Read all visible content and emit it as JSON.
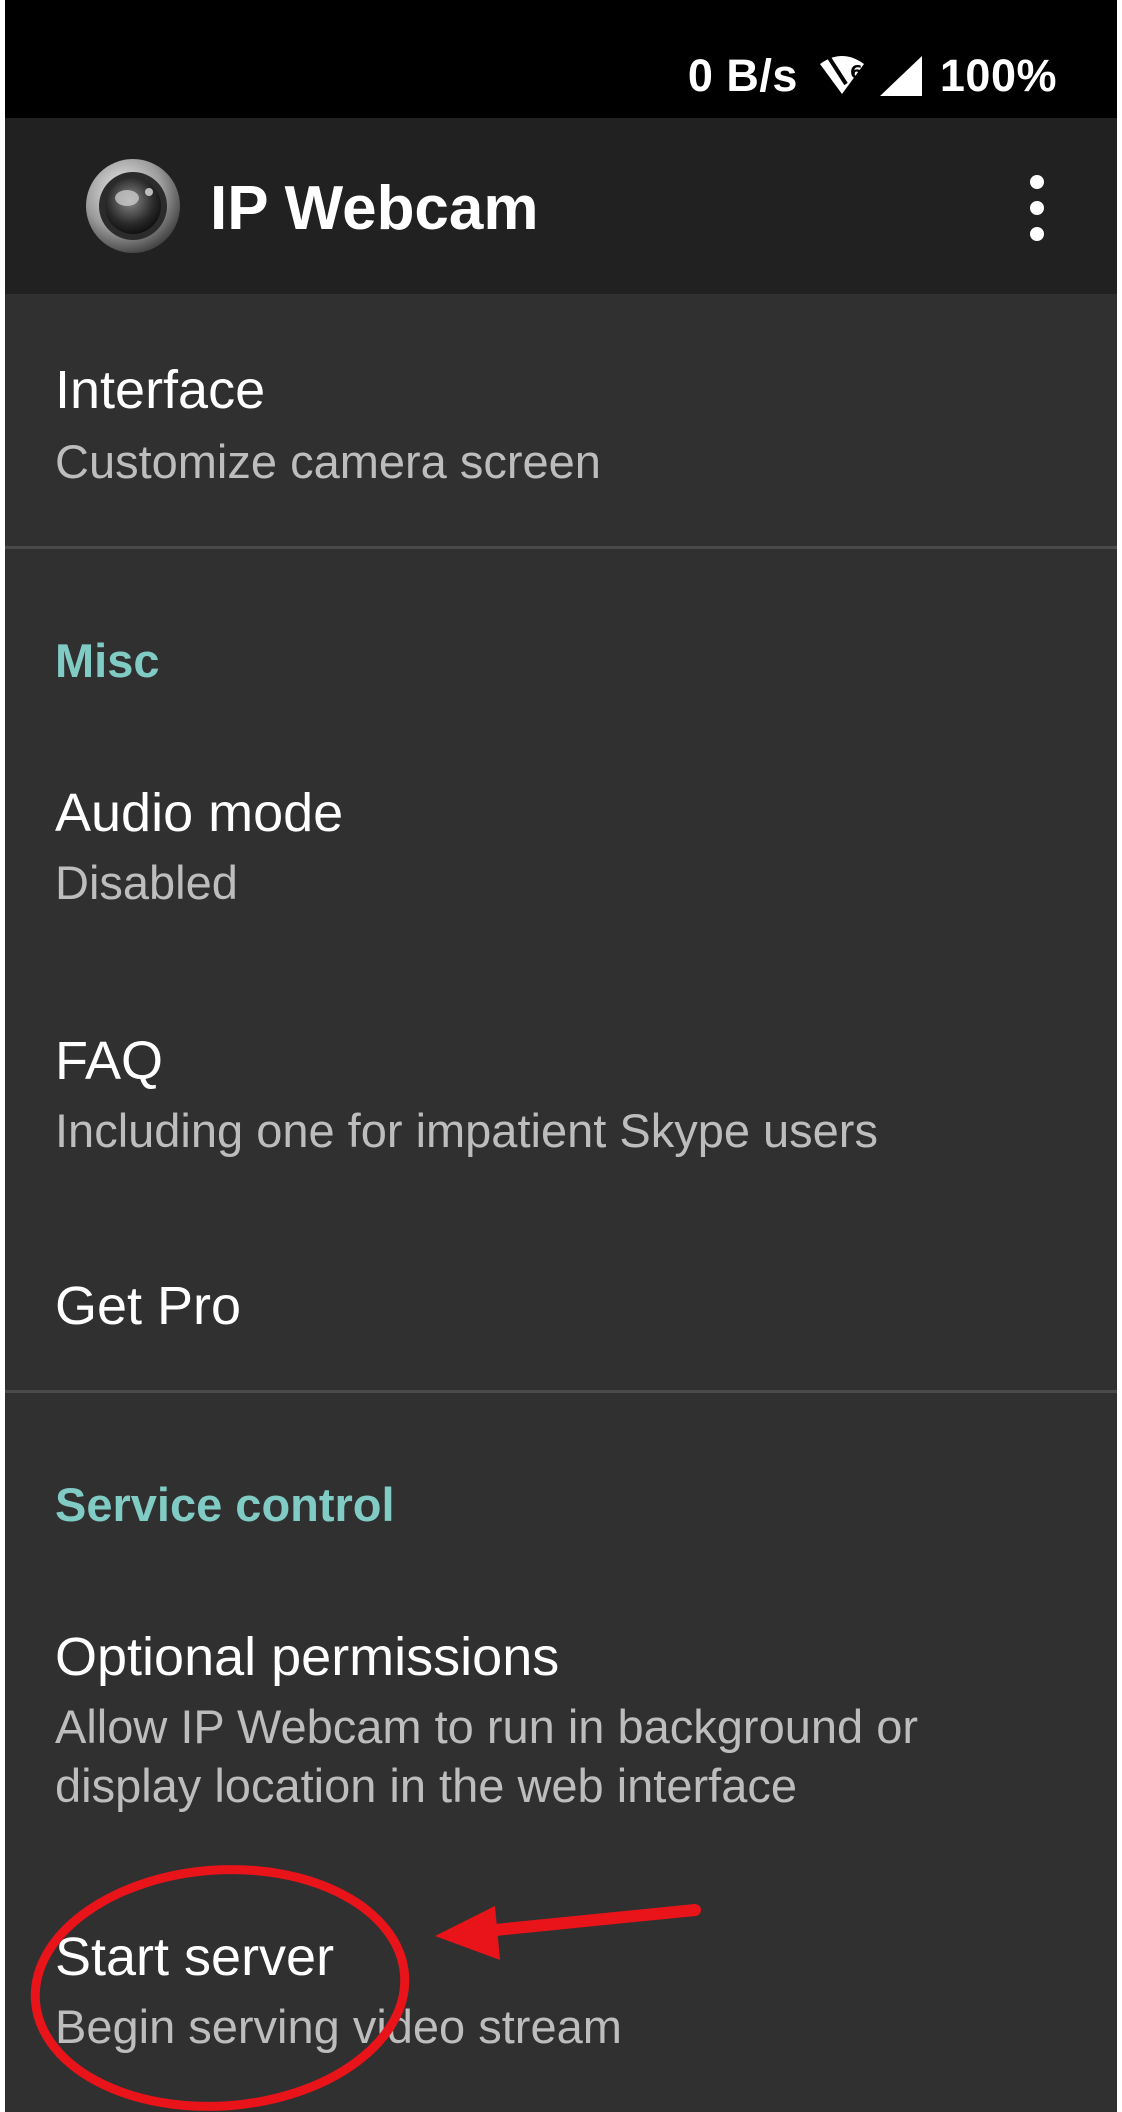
{
  "status_bar": {
    "net_speed": "0 B/s",
    "wifi_badge": "6",
    "battery": "100%",
    "icons": [
      "wifi-icon",
      "signal-icon"
    ]
  },
  "app_bar": {
    "title": "IP Webcam",
    "logo_icon": "camera-lens-icon",
    "menu_icon": "more-vert-icon"
  },
  "preferences": {
    "interface": {
      "title": "Interface",
      "summary": "Customize camera screen"
    },
    "misc_category": "Misc",
    "audio_mode": {
      "title": "Audio mode",
      "summary": "Disabled"
    },
    "faq": {
      "title": "FAQ",
      "summary": "Including one for impatient Skype users"
    },
    "get_pro": {
      "title": "Get Pro"
    },
    "service_category": "Service control",
    "optional_permissions": {
      "title": "Optional permissions",
      "summary_line1": "Allow IP Webcam to run in background or",
      "summary_line2": "display location in the web interface"
    },
    "start_server": {
      "title": "Start server",
      "summary": "Begin serving video stream"
    }
  },
  "colors": {
    "background": "#303030",
    "app_bar": "#212121",
    "accent": "#80cbc4",
    "annotation": "#e8141a"
  }
}
